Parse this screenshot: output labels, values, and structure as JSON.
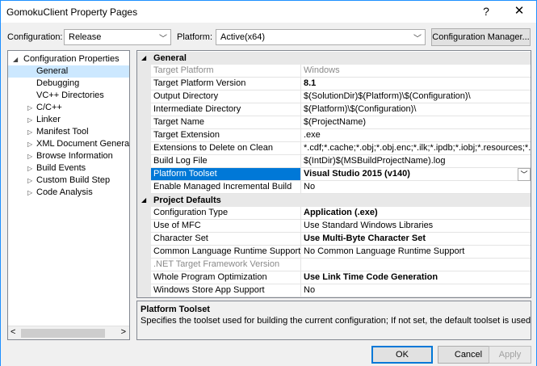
{
  "window": {
    "title": "GomokuClient Property Pages",
    "help": "?",
    "close": "✕"
  },
  "config_bar": {
    "configuration_label": "Configuration:",
    "configuration_value": "Release",
    "platform_label": "Platform:",
    "platform_value": "Active(x64)",
    "manager_button": "Configuration Manager..."
  },
  "tree": {
    "items": [
      {
        "label": "Configuration Properties",
        "expander": "◢"
      },
      {
        "label": "General"
      },
      {
        "label": "Debugging"
      },
      {
        "label": "VC++ Directories"
      },
      {
        "label": "C/C++",
        "expander": "▷"
      },
      {
        "label": "Linker",
        "expander": "▷"
      },
      {
        "label": "Manifest Tool",
        "expander": "▷"
      },
      {
        "label": "XML Document Generator",
        "expander": "▷"
      },
      {
        "label": "Browse Information",
        "expander": "▷"
      },
      {
        "label": "Build Events",
        "expander": "▷"
      },
      {
        "label": "Custom Build Step",
        "expander": "▷"
      },
      {
        "label": "Code Analysis",
        "expander": "▷"
      }
    ],
    "scroll_left": "<",
    "scroll_right": ">"
  },
  "grid": {
    "general": {
      "title": "General",
      "caret": "◢",
      "rows": [
        {
          "name": "Target Platform",
          "value": "Windows"
        },
        {
          "name": "Target Platform Version",
          "value": "8.1"
        },
        {
          "name": "Output Directory",
          "value": "$(SolutionDir)$(Platform)\\$(Configuration)\\"
        },
        {
          "name": "Intermediate Directory",
          "value": "$(Platform)\\$(Configuration)\\"
        },
        {
          "name": "Target Name",
          "value": "$(ProjectName)"
        },
        {
          "name": "Target Extension",
          "value": ".exe"
        },
        {
          "name": "Extensions to Delete on Clean",
          "value": "*.cdf;*.cache;*.obj;*.obj.enc;*.ilk;*.ipdb;*.iobj;*.resources;*.tlb;*.tli;"
        },
        {
          "name": "Build Log File",
          "value": "$(IntDir)$(MSBuildProjectName).log"
        },
        {
          "name": "Platform Toolset",
          "value": "Visual Studio 2015 (v140)"
        },
        {
          "name": "Enable Managed Incremental Build",
          "value": "No"
        }
      ]
    },
    "project_defaults": {
      "title": "Project Defaults",
      "caret": "◢",
      "rows": [
        {
          "name": "Configuration Type",
          "value": "Application (.exe)"
        },
        {
          "name": "Use of MFC",
          "value": "Use Standard Windows Libraries"
        },
        {
          "name": "Character Set",
          "value": "Use Multi-Byte Character Set"
        },
        {
          "name": "Common Language Runtime Support",
          "value": "No Common Language Runtime Support"
        },
        {
          "name": ".NET Target Framework Version",
          "value": ""
        },
        {
          "name": "Whole Program Optimization",
          "value": "Use Link Time Code Generation"
        },
        {
          "name": "Windows Store App Support",
          "value": "No"
        }
      ]
    }
  },
  "description": {
    "title": "Platform Toolset",
    "text": "Specifies the toolset used for building the current configuration; If not set, the default toolset is used"
  },
  "buttons": {
    "ok": "OK",
    "cancel": "Cancel",
    "apply": "Apply"
  },
  "colors": {
    "accent": "#0078d7",
    "selection": "#cce8ff"
  }
}
